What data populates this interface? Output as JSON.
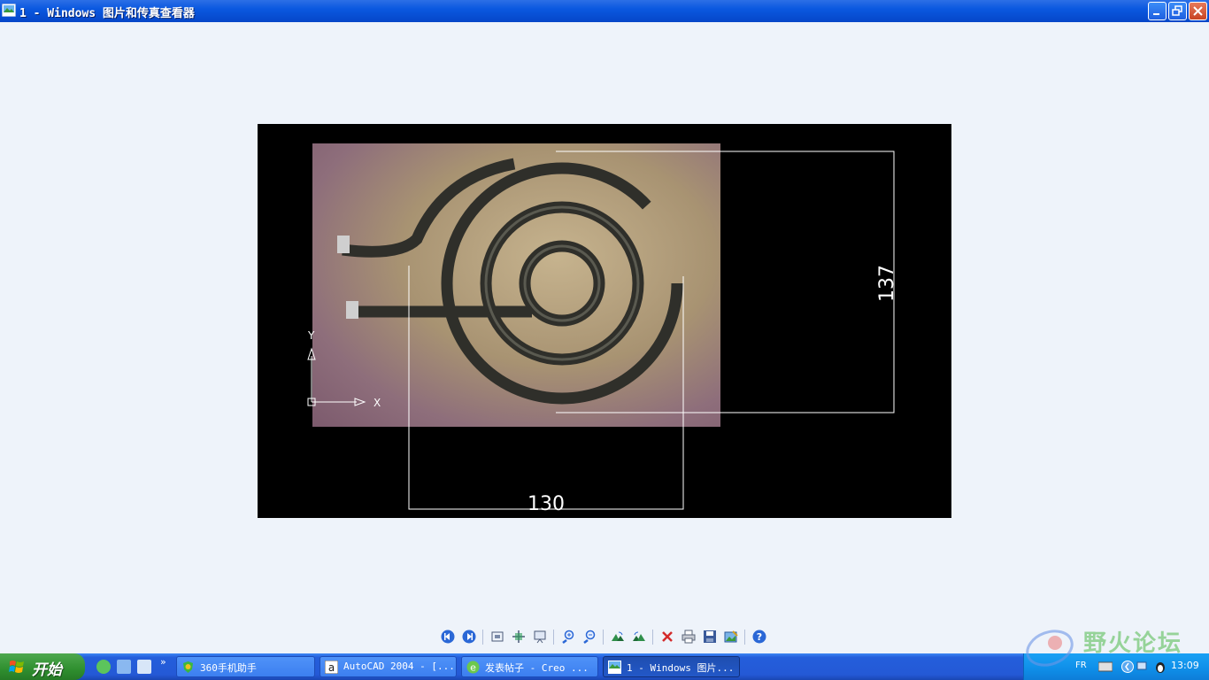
{
  "window": {
    "title": "1 - Windows 图片和传真查看器"
  },
  "image": {
    "dim_vertical": "137",
    "dim_horizontal": "130",
    "axis_y": "Y",
    "axis_x": "X"
  },
  "toolbar": {
    "buttons": [
      {
        "name": "previous-image",
        "icon": "prev-icon"
      },
      {
        "name": "next-image",
        "icon": "next-icon"
      },
      {
        "name": "best-fit",
        "icon": "best-fit-icon"
      },
      {
        "name": "actual-size",
        "icon": "actual-size-icon"
      },
      {
        "name": "slideshow",
        "icon": "slideshow-icon"
      },
      {
        "name": "zoom-in",
        "icon": "zoom-in-icon"
      },
      {
        "name": "zoom-out",
        "icon": "zoom-out-icon"
      },
      {
        "name": "rotate-clockwise",
        "icon": "rotate-cw-icon"
      },
      {
        "name": "rotate-counterclockwise",
        "icon": "rotate-ccw-icon"
      },
      {
        "name": "delete",
        "icon": "delete-icon"
      },
      {
        "name": "print",
        "icon": "print-icon"
      },
      {
        "name": "save-copy",
        "icon": "save-icon"
      },
      {
        "name": "edit",
        "icon": "edit-icon"
      },
      {
        "name": "help",
        "icon": "help-icon"
      }
    ]
  },
  "taskbar": {
    "start_label": "开始",
    "tasks": [
      {
        "label": "360手机助手"
      },
      {
        "label": "AutoCAD 2004 - [..."
      },
      {
        "label": "发表帖子 - Creo ..."
      },
      {
        "label": "1 - Windows 图片..."
      }
    ],
    "tray": {
      "language": "FR",
      "clock": "13:09"
    }
  },
  "watermark": {
    "text": "野火论坛"
  },
  "colors": {
    "titlebar": "#0a58e0",
    "taskbar": "#245edb",
    "start": "#2f8f2f",
    "tray": "#0f8ee8",
    "viewer_bg": "#eef3fa",
    "drawing_line": "#ffffff"
  }
}
